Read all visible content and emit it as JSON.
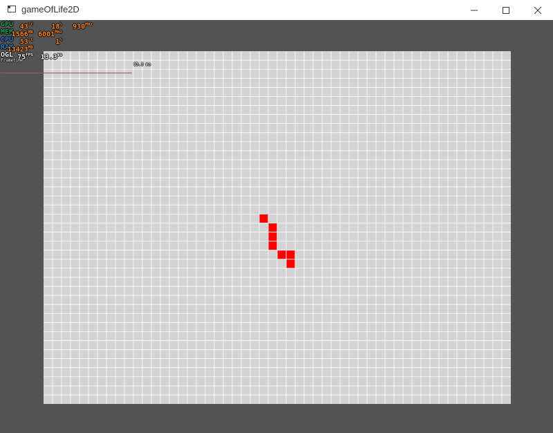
{
  "window": {
    "title": "gameOfLife2D",
    "controls": {
      "minimize": "—",
      "maximize": "☐",
      "close": "✕"
    }
  },
  "colors": {
    "background": "#535353",
    "grid_fill": "#d3d3d3",
    "grid_line": "#ffffff",
    "cell_alive": "#ff0000"
  },
  "grid": {
    "columns": 52,
    "rows": 39,
    "alive_cells": [
      [
        24,
        18
      ],
      [
        25,
        19
      ],
      [
        25,
        20
      ],
      [
        25,
        21
      ],
      [
        26,
        22
      ],
      [
        27,
        22
      ],
      [
        27,
        23
      ]
    ]
  },
  "overlay": {
    "rows": [
      {
        "label": "GPU",
        "label_color": "#1fa05a",
        "v1": "43",
        "u1": "°C",
        "v2": "18",
        "u2": "%",
        "v3": "930",
        "u3": "MHz"
      },
      {
        "label": "MEM",
        "label_color": "#1fa05a",
        "v1": "1566",
        "u1": "MB",
        "v2": "6001",
        "u2": "MHz",
        "v3": "",
        "u3": ""
      },
      {
        "label": "CPU",
        "label_color": "#2f7fc8",
        "v1": "53",
        "u1": "°C",
        "v2": "1",
        "u2": "%",
        "v3": "",
        "u3": ""
      },
      {
        "label": "RAM",
        "label_color": "#2f7fc8",
        "v1": "13423",
        "u1": "MB",
        "v2": "",
        "u2": "",
        "v3": "",
        "u3": ""
      },
      {
        "label": "OGL",
        "label_color": "#ffffff",
        "v1": "75",
        "u1": "FPS",
        "v2": "13.3",
        "u2": "ms",
        "v3": "",
        "u3": ""
      }
    ],
    "frametime_label": "Frametime",
    "frametime_ms": "13.3 ms"
  }
}
